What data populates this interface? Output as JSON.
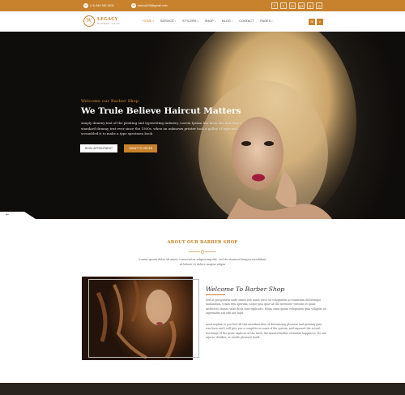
{
  "topbar": {
    "phone": "(+1) 840 162 2404",
    "email": "haircut100@gmail.com",
    "socials": [
      {
        "icon": "facebook-icon",
        "glyph": "f"
      },
      {
        "icon": "twitter-icon",
        "glyph": "t"
      },
      {
        "icon": "linkedin-icon",
        "glyph": "in"
      },
      {
        "icon": "google-plus-icon",
        "glyph": "g+"
      },
      {
        "icon": "pinterest-icon",
        "glyph": "p"
      },
      {
        "icon": "instagram-icon",
        "glyph": "◎"
      }
    ]
  },
  "brand": {
    "name": "LEGACY",
    "sub": "BARBER SHOP",
    "mark": "W"
  },
  "nav": {
    "items": [
      {
        "label": "HOME",
        "caret": true,
        "active": true
      },
      {
        "label": "SERVICE",
        "caret": true
      },
      {
        "label": "STYLERS",
        "caret": true
      },
      {
        "label": "SHOP",
        "caret": true
      },
      {
        "label": "BLOG",
        "caret": true
      },
      {
        "label": "CONTACT",
        "caret": false
      },
      {
        "label": "PAGES",
        "caret": true
      }
    ],
    "cart_icon": "cart-icon",
    "search_icon": "search-icon"
  },
  "hero": {
    "eyebrow": "Welcome our Barber Shop",
    "title": "We Trule Believe Haircut Matters",
    "description": "simply dummy text of the printing and typesetting industry. Lorem Ipsum has been the industry's standard dummy text ever since the 1500s, when an unknown printer took a galley of type and scrambled it to make a type specimen book",
    "btn_primary": "BOOK APPOINTMENT",
    "btn_secondary": "I WANT TO ORDER"
  },
  "about": {
    "title": "ABOUT OUR BARBER SHOP",
    "intro": "Lorem ipsum dolor sit amet, consectetur adipisicing elit, sed do eiusmod tempor incididunt ut labore et dolore magna aliqua",
    "welcome_title": "Welcome To Barber Shop",
    "paragraphs": [
      "Sed ut perspiciatis unde omnis iste natus error sit voluptatem accusantium doloremque laudantium, totam rem aperiam, eaque ipsa quae ab illo inventore veritatis et quasi architecto beatae vitae dicta sunt explicabo. Nemo enim ipsam voluptatem quia voluptas sit aspernatur aut odit aut fugit.",
      "must explain to you how all this mistaken idea of denouncing pleasure and praising pain was born and I will give you a complete account of the system, and expound the actual teachings of the great explorer of the truth, the master-builder of human happiness. No one rejects, dislikes, or avoids pleasure itself."
    ]
  },
  "colors": {
    "accent": "#c8822d",
    "dark": "#1a1612",
    "text": "#333333"
  }
}
